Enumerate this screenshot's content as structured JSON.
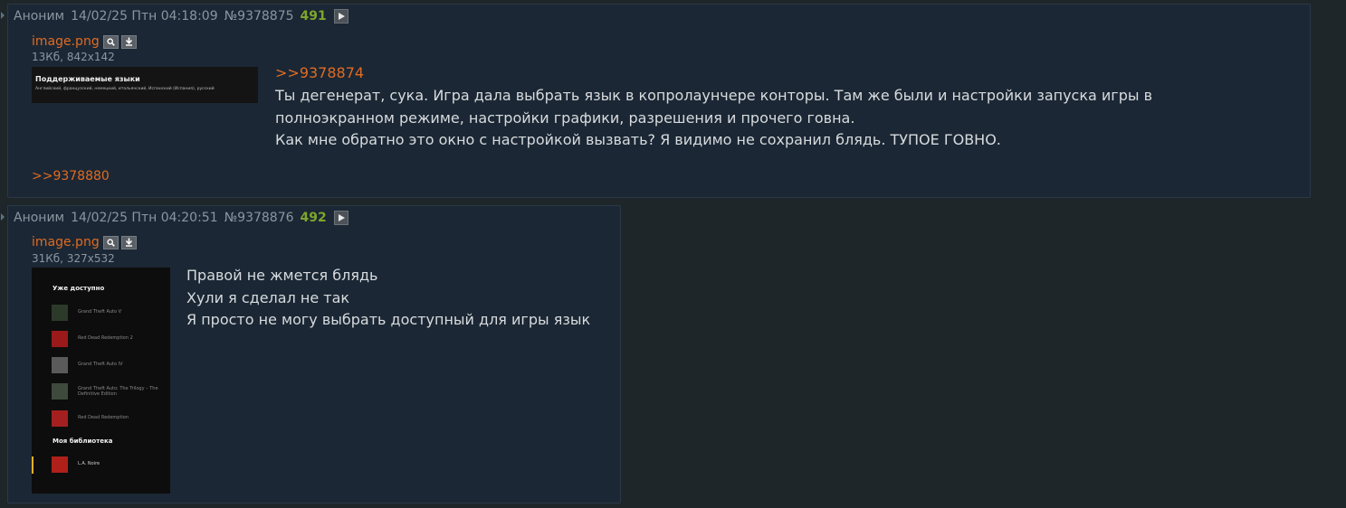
{
  "posts": [
    {
      "author": "Аноним",
      "datetime": "14/02/25 Птн 04:18:09",
      "number": "№9378875",
      "counter": "491",
      "file": {
        "name": "image.png",
        "meta": "13Кб, 842x142"
      },
      "thumb": {
        "title": "Поддерживаемые языки",
        "subtitle": "Английский, французский, немецкий, итальянский, Испанский (Испания), русский"
      },
      "quote": ">>9378874",
      "lines": [
        "Ты дегенерат, сука. Игра дала выбрать язык в копролаунчере конторы. Там же были и настройки запуска игры в",
        "полноэкранном режиме, настройки графики, разрешения и прочего говна.",
        "Как мне обратно это окно с настройкой вызвать? Я видимо не сохранил блядь. ТУПОЕ ГОВНО."
      ],
      "reply": ">>9378880"
    },
    {
      "author": "Аноним",
      "datetime": "14/02/25 Птн 04:20:51",
      "number": "№9378876",
      "counter": "492",
      "file": {
        "name": "image.png",
        "meta": "31Кб, 327x532"
      },
      "thumb": {
        "section_available": "Уже доступно",
        "games": [
          "Grand Theft Auto V",
          "Red Dead Redemption 2",
          "Grand Theft Auto IV",
          "Grand Theft Auto: The Trilogy – The Definitive Edition",
          "Red Dead Redemption"
        ],
        "section_library": "Моя библиотека",
        "library_games": [
          "L.A. Noire"
        ]
      },
      "lines": [
        "Правой не жмется блядь",
        "Хули я сделал не так",
        "Я просто не могу выбрать доступный для игры язык"
      ]
    }
  ],
  "colors": {
    "background": "#1e2629",
    "post_bg": "#1b2734",
    "link": "#e06b22",
    "counter": "#7ea62b",
    "text": "#d7dbde",
    "meta": "#8a96a0"
  },
  "icons": [
    "play-icon",
    "search-icon",
    "download-icon",
    "post-arrow-icon"
  ]
}
